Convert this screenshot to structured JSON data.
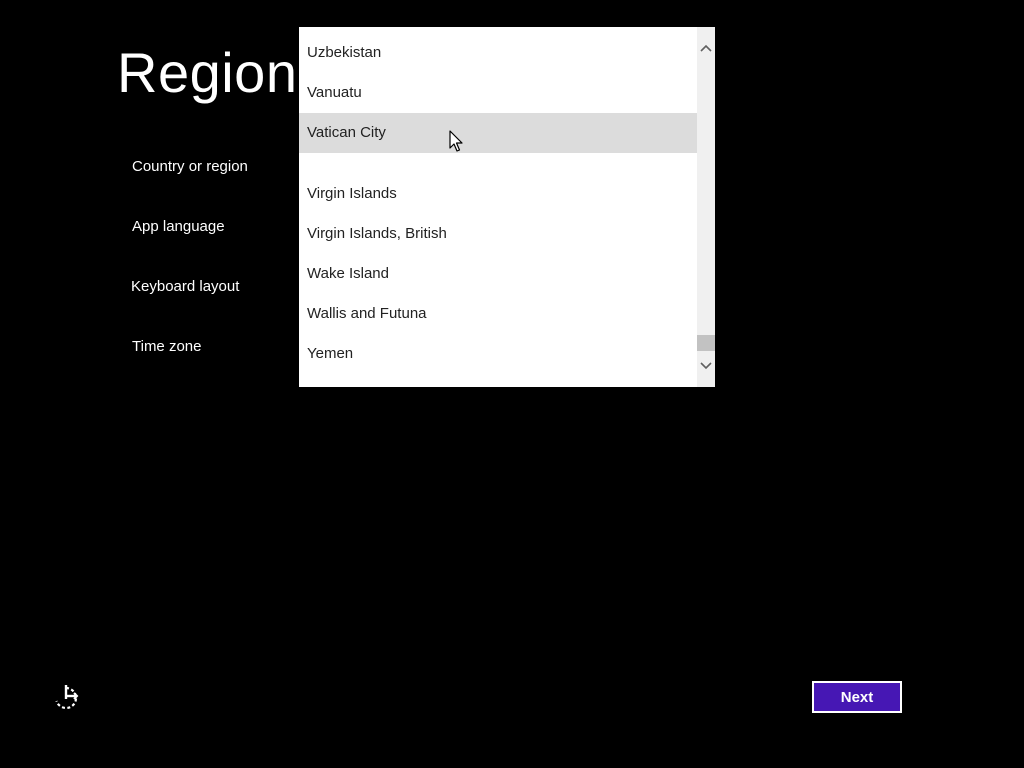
{
  "page": {
    "title": "Region"
  },
  "fields": [
    {
      "label": "Country or region"
    },
    {
      "label": "App language"
    },
    {
      "label": "Keyboard layout"
    },
    {
      "label": "Time zone"
    }
  ],
  "country_dropdown": {
    "items": [
      {
        "label": "Uzbekistan",
        "hovered": false
      },
      {
        "label": "Vanuatu",
        "hovered": false
      },
      {
        "label": "Vatican City",
        "hovered": true
      },
      {
        "label": "Virgin Islands",
        "hovered": false
      },
      {
        "label": "Virgin Islands, British",
        "hovered": false
      },
      {
        "label": "Wake Island",
        "hovered": false
      },
      {
        "label": "Wallis and Futuna",
        "hovered": false
      },
      {
        "label": "Yemen",
        "hovered": false
      }
    ],
    "scroll_position": 0.97,
    "icons": {
      "scroll_up": "chevron-up-icon",
      "scroll_down": "chevron-down-icon",
      "cursor": "mouse-pointer-icon"
    }
  },
  "footer": {
    "ease_of_access_icon": "ease-of-access-icon",
    "next_label": "Next"
  },
  "colors": {
    "background": "#000000",
    "accent": "#4617b4",
    "hover_row": "#dcdcdc",
    "text_light": "#ffffff",
    "text_dark": "#222222"
  }
}
